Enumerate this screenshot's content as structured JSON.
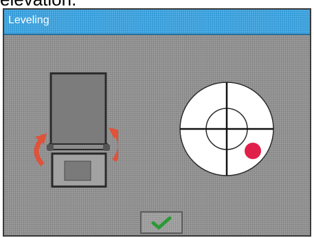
{
  "window": {
    "title": "Leveling",
    "top_caption": "elevation."
  },
  "bubble_level": {
    "target": "crosshair",
    "indicator": "red-dot",
    "indicator_color": "#e0204a"
  },
  "actions": {
    "confirm_icon": "checkmark-icon",
    "confirm_color": "#2c9a36"
  },
  "colors": {
    "titlebar": "#2f98d6",
    "background": "#9c9c9c",
    "arrow": "#e0523a"
  }
}
